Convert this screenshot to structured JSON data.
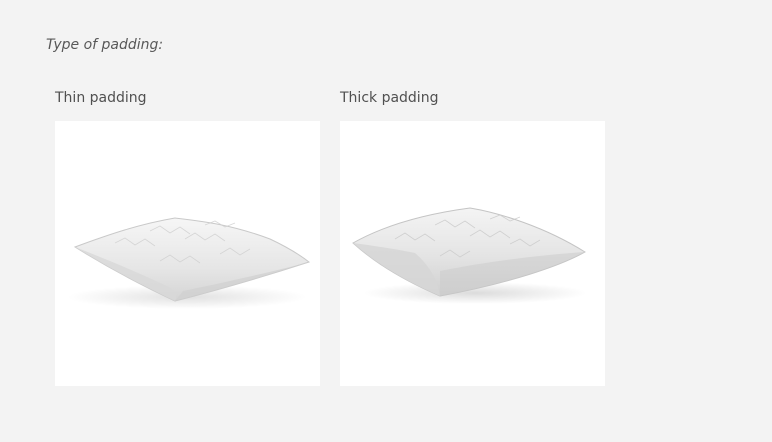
{
  "section": {
    "title": "Type of padding:"
  },
  "options": [
    {
      "label": "Thin padding",
      "image_icon": "thin-pillow-image"
    },
    {
      "label": "Thick padding",
      "image_icon": "thick-pillow-image"
    }
  ],
  "colors": {
    "page_background": "#f3f3f3",
    "card_background": "#ffffff",
    "text": "#505050"
  }
}
